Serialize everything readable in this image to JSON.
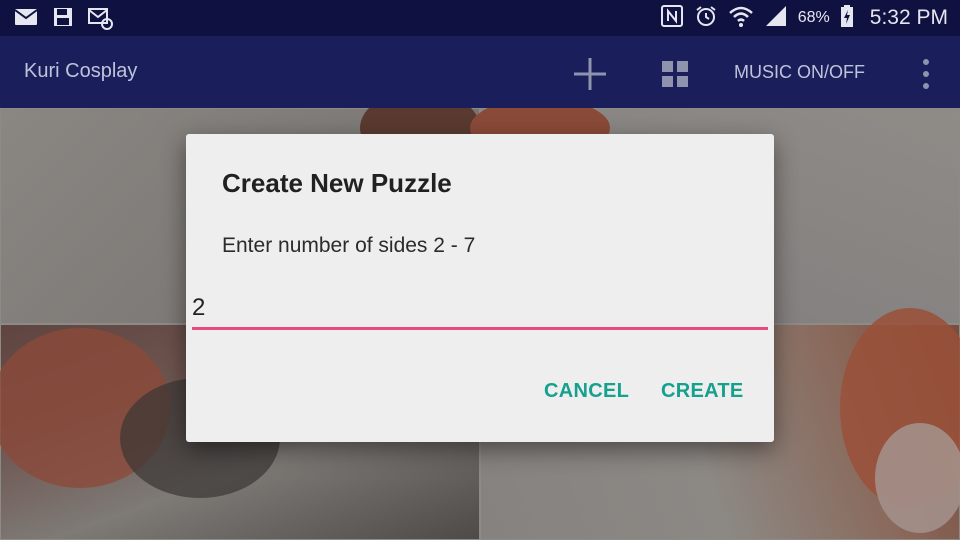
{
  "status_bar": {
    "battery": "68%",
    "time": "5:32 PM"
  },
  "toolbar": {
    "title": "Kuri Cosplay",
    "music_label": "MUSIC ON/OFF"
  },
  "dialog": {
    "title": "Create New Puzzle",
    "message": "Enter number of sides 2 - 7",
    "input_value": "2",
    "cancel_label": "CANCEL",
    "create_label": "CREATE"
  },
  "colors": {
    "status_bar": "#0f1240",
    "toolbar": "#1a1f5c",
    "accent_underline": "#e84a7f",
    "button_text": "#16a08e"
  },
  "icons": [
    "email-icon",
    "save-icon",
    "mail-settings-icon",
    "nfc-icon",
    "alarm-icon",
    "wifi-icon",
    "signal-icon",
    "battery-charging-icon",
    "add-icon",
    "grid-icon",
    "overflow-menu-icon"
  ]
}
